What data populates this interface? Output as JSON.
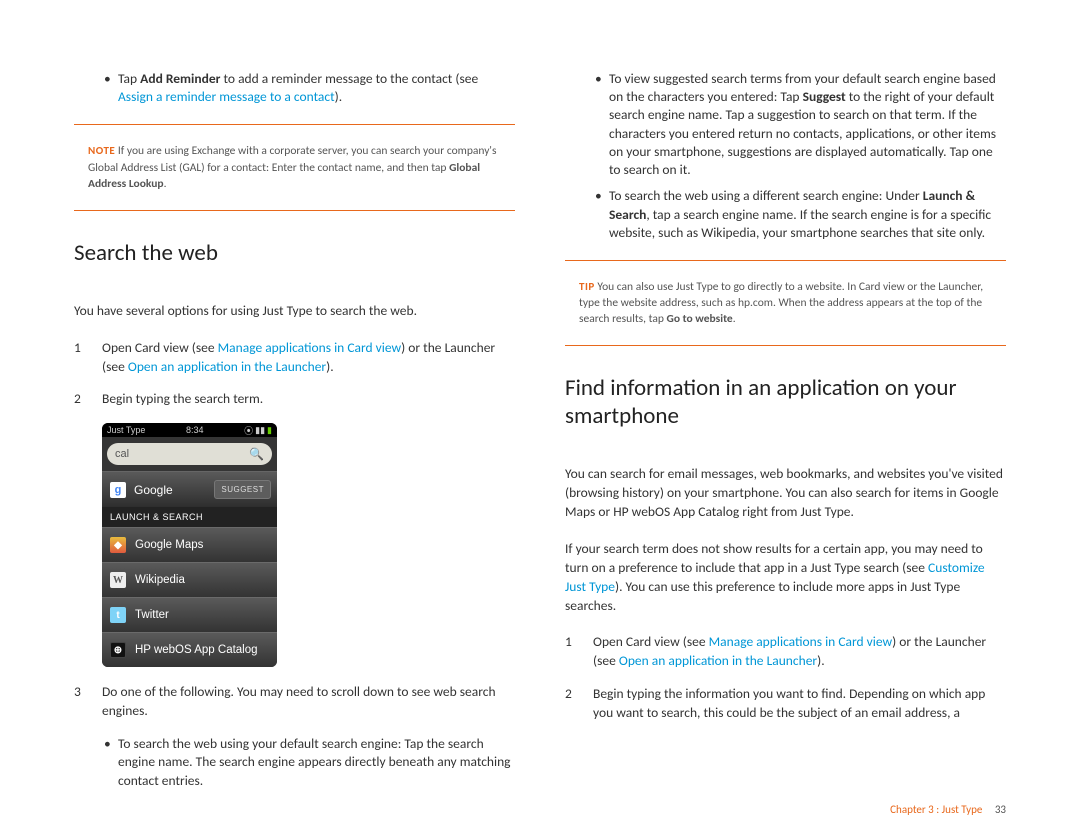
{
  "left": {
    "top_bullet": {
      "pre": "Tap ",
      "bold": "Add Reminder",
      "mid": " to add a reminder message to the contact (see ",
      "link": "Assign a reminder message to a contact",
      "post": ")."
    },
    "note": {
      "label": "NOTE",
      "text_pre": " If you are using Exchange with a corporate server, you can search your company's Global Address List (GAL) for a contact: Enter the contact name, and then tap ",
      "bold": "Global Address Lookup",
      "text_post": "."
    },
    "heading": "Search the web",
    "intro": "You have several options for using Just Type to search the web.",
    "step1": {
      "pre": "Open Card view (see ",
      "link1": "Manage applications in Card view",
      "mid": ") or the Launcher (see ",
      "link2": "Open an application in the Launcher",
      "post": ")."
    },
    "step2": "Begin typing the search term.",
    "phone": {
      "status_left": "Just Type",
      "status_time": "8:34",
      "search_value": "cal",
      "google": "Google",
      "suggest": "SUGGEST",
      "section": "LAUNCH & SEARCH",
      "rows": [
        "Google Maps",
        "Wikipedia",
        "Twitter",
        "HP webOS App Catalog"
      ]
    },
    "step3": "Do one of the following. You may need to scroll down to see web search engines.",
    "step3_bullet": "To search the web using your default search engine: Tap the search engine name. The search engine appears directly beneath any matching contact entries."
  },
  "right": {
    "b1": {
      "pre": "To view suggested search terms from your default search engine based on the characters you entered: Tap ",
      "bold": "Suggest",
      "post": " to the right of your default search engine name. Tap a suggestion to search on that term. If the characters you entered return no contacts, applications, or other items on your smartphone, suggestions are displayed automatically. Tap one to search on it."
    },
    "b2": {
      "pre": "To search the web using a different search engine: Under ",
      "bold": "Launch & Search",
      "post": ", tap a search engine name. If the search engine is for a specific website, such as Wikipedia, your smartphone searches that site only."
    },
    "tip": {
      "label": "TIP",
      "text_pre": " You can also use Just Type to go directly to a website. In Card view or the Launcher, type the website address, such as hp.com. When the address appears at the top of the search results, tap ",
      "bold": "Go to website",
      "text_post": "."
    },
    "heading": "Find information in an application on your smartphone",
    "para1": "You can search for email messages, web bookmarks, and websites you've visited (browsing history) on your smartphone. You can also search for items in Google Maps or HP webOS App Catalog right from Just Type.",
    "para2": {
      "pre": "If your search term does not show results for a certain app, you may need to turn on a preference to include that app in a Just Type search (see ",
      "link": "Customize Just Type",
      "post": "). You can use this preference to include more apps in Just Type searches."
    },
    "step1": {
      "pre": "Open Card view (see ",
      "link1": "Manage applications in Card view",
      "mid": ") or the Launcher (see ",
      "link2": "Open an application in the Launcher",
      "post": ")."
    },
    "step2": "Begin typing the information you want to find. Depending on which app you want to search, this could be the subject of an email address, a"
  },
  "footer": {
    "chapter": "Chapter 3  :  Just Type",
    "page": "33"
  }
}
